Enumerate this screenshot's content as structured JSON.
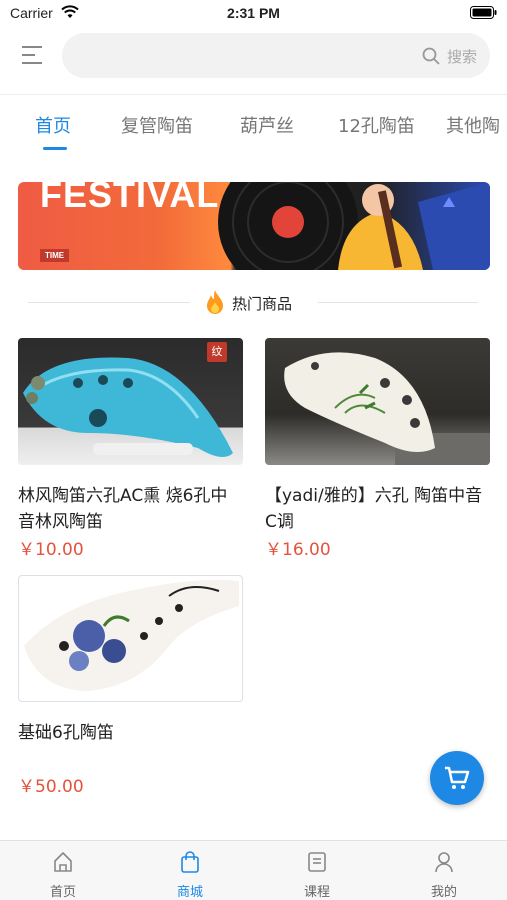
{
  "status_bar": {
    "carrier": "Carrier",
    "time": "2:31 PM"
  },
  "search": {
    "label": "搜索",
    "icon": "search-icon"
  },
  "tabs": [
    {
      "label": "首页",
      "active": true
    },
    {
      "label": "复管陶笛",
      "active": false
    },
    {
      "label": "葫芦丝",
      "active": false
    },
    {
      "label": "12孔陶笛",
      "active": false
    },
    {
      "label": "其他陶",
      "active": false
    }
  ],
  "banner": {
    "headline": "FESTIVAL",
    "tag": "TIME"
  },
  "section": {
    "title": "热门商品",
    "icon": "fire-icon"
  },
  "products": [
    {
      "title": "林风陶笛六孔AC熏 烧6孔中音林风陶笛",
      "price": "￥10.00",
      "badge": "纹"
    },
    {
      "title": "【yadi/雅的】六孔 陶笛中音C调",
      "price": "￥16.00"
    },
    {
      "title": "基础6孔陶笛",
      "price": "￥50.00"
    }
  ],
  "bottom_nav": [
    {
      "label": "首页",
      "icon": "home-icon",
      "active": false
    },
    {
      "label": "商城",
      "icon": "shopping-bag-icon",
      "active": true
    },
    {
      "label": "课程",
      "icon": "book-icon",
      "active": false
    },
    {
      "label": "我的",
      "icon": "user-icon",
      "active": false
    }
  ],
  "colors": {
    "accent": "#1e88e5",
    "price": "#e5533d"
  }
}
